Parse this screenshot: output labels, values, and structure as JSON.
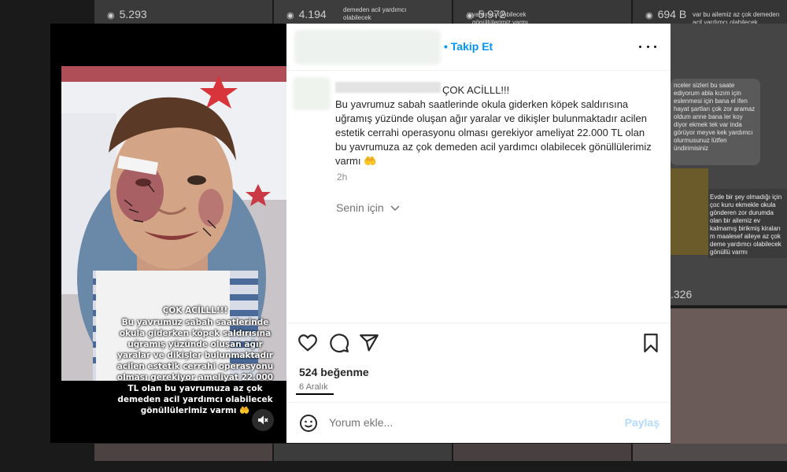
{
  "background": {
    "counts": [
      "5.293",
      "4.194",
      "5.972",
      "694 B"
    ],
    "side_count": ".326",
    "captions": {
      "top_left": "demeden acil yardımcı olabilecek",
      "top_mid": "yardımcı olabilecek gönüllülerimiz varmı",
      "top_right": "var bu ailemiz az çok demeden acil yardımcı olabilecek gönüllülerimiz varmı",
      "right_chat": "nceler sizleri bu saate ediyorum abla kızım için eslenmesi için bana el ifen hayat şartları çok zor aramaz oldum anne bana ler koy diyor ekmek tek var inda görüyor meyve kek yardımcı olurmusunuz lütfen ündirimisiniz",
      "right_card": "Evde bir şey olmadığı için çoc kuru ekmekle okula gönderen zor durumda olan bir ailemiz ev kalmamış birikmiş kiraları m maalesef aileye az çok deme yardımcı olabilecek gönüllü varmı"
    }
  },
  "story": {
    "title": "ÇOK ACİLLL!!!",
    "body": "Bu yavrumuz sabah saatlerinde okula giderken köpek saldırısına uğramış yüzünde oluşan ağır yaralar ve dikişler bulunmaktadır acilen estetik cerrahi operasyonu olması gerekiyor ameliyat 22.000 TL olan bu yavrumuza az çok demeden acil yardımcı olabilecek gönüllülerimiz varmı 🤲"
  },
  "header": {
    "follow_label": "• Takip Et"
  },
  "caption": {
    "title": "ÇOK ACİLLL!!!",
    "body": "Bu yavrumuz sabah saatlerinde okula giderken köpek saldırısına uğramış yüzünde oluşan ağır yaralar ve dikişler bulunmaktadır acilen estetik cerrahi operasyonu olması gerekiyor ameliyat 22.000 TL olan bu yavrumuza az çok demeden acil yardımcı olabilecek gönüllülerimiz varmı 🤲",
    "time": "2h",
    "for_you": "Senin için"
  },
  "post": {
    "likes": "524 beğenme",
    "date": "6 Aralık"
  },
  "comment": {
    "placeholder": "Yorum ekle...",
    "share_label": "Paylaş"
  },
  "icons": [
    "heart-icon",
    "comment-icon",
    "share-icon",
    "bookmark-icon",
    "emoji-icon",
    "mute-icon",
    "more-icon",
    "chevron-down-icon",
    "eye-icon"
  ],
  "colors": {
    "accent": "#0095f6",
    "share_disabled": "#b3dbff"
  }
}
